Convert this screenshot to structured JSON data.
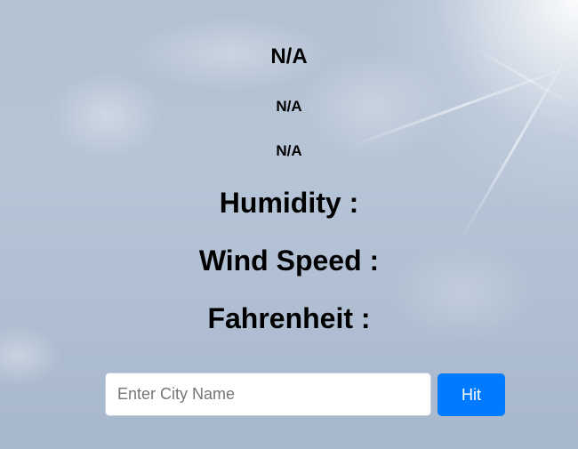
{
  "weather": {
    "city": "N/A",
    "temperature": "N/A",
    "description": "N/A",
    "humidity_label": "Humidity :",
    "wind_speed_label": "Wind Speed :",
    "fahrenheit_label": "Fahrenheit :"
  },
  "search": {
    "placeholder": "Enter City Name",
    "value": "",
    "button_label": "Hit"
  },
  "colors": {
    "button_bg": "#007bff",
    "button_text": "#ffffff",
    "text": "#000000"
  }
}
